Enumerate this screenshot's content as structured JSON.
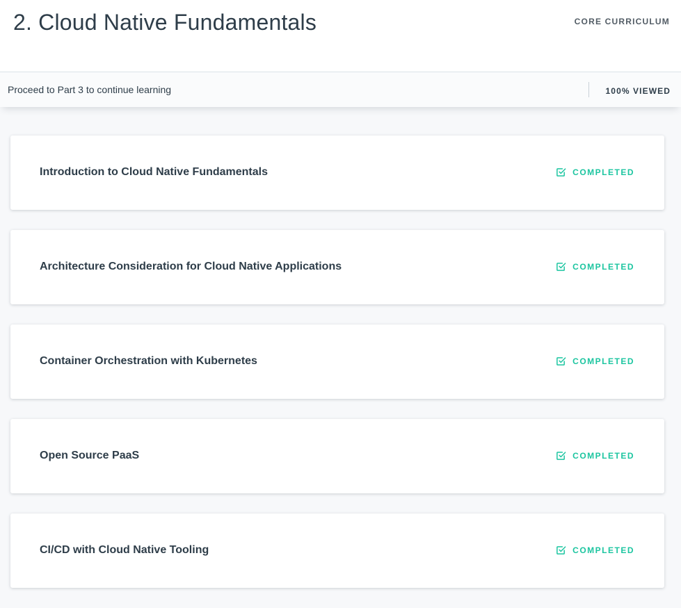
{
  "header": {
    "title": "2. Cloud Native Fundamentals",
    "section_label": "CORE CURRICULUM"
  },
  "progress": {
    "message": "Proceed to Part 3 to continue learning",
    "status": "100% VIEWED",
    "percent_viewed": 100
  },
  "colors": {
    "completed": "#1cc5a0",
    "text": "#2e3d49"
  },
  "lessons": [
    {
      "title": "Introduction to Cloud Native Fundamentals",
      "status": "COMPLETED",
      "icon": "checkbox-checked-icon"
    },
    {
      "title": "Architecture Consideration for Cloud Native Applications",
      "status": "COMPLETED",
      "icon": "checkbox-checked-icon"
    },
    {
      "title": "Container Orchestration with Kubernetes",
      "status": "COMPLETED",
      "icon": "checkbox-checked-icon"
    },
    {
      "title": "Open Source PaaS",
      "status": "COMPLETED",
      "icon": "checkbox-checked-icon"
    },
    {
      "title": "CI/CD with Cloud Native Tooling",
      "status": "COMPLETED",
      "icon": "checkbox-checked-icon"
    }
  ]
}
